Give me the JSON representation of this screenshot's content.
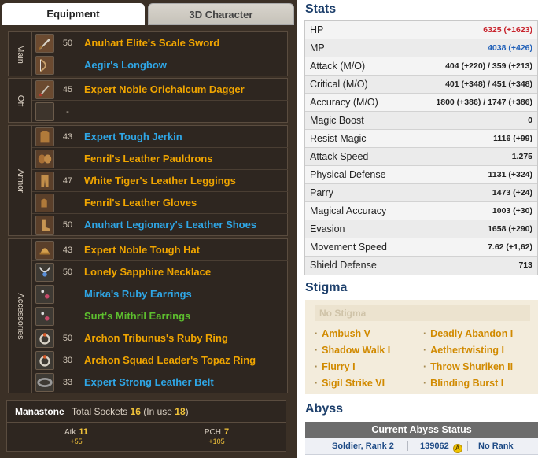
{
  "tabs": {
    "equipment": "Equipment",
    "character_3d": "3D Character"
  },
  "groups": {
    "main": "Main",
    "off": "Off",
    "armor": "Armor",
    "accessories": "Accessories"
  },
  "items": {
    "main": [
      {
        "level": "50",
        "name": "Anuhart Elite's Scale Sword",
        "icon": "sword-icon",
        "color": "#f0a500"
      },
      {
        "level": "",
        "name": "Aegir's Longbow",
        "icon": "bow-icon",
        "color": "#2fa6e6"
      }
    ],
    "off": [
      {
        "level": "45",
        "name": "Expert Noble Orichalcum Dagger",
        "icon": "dagger-icon",
        "color": "#f0a500"
      },
      {
        "level": "-",
        "name": "",
        "icon": "empty-slot-icon",
        "color": ""
      }
    ],
    "armor": [
      {
        "level": "43",
        "name": "Expert Tough Jerkin",
        "icon": "jerkin-icon",
        "color": "#2fa6e6"
      },
      {
        "level": "",
        "name": "Fenril's Leather Pauldrons",
        "icon": "pauldrons-icon",
        "color": "#f0a500"
      },
      {
        "level": "47",
        "name": "White Tiger's Leather Leggings",
        "icon": "leggings-icon",
        "color": "#f0a500"
      },
      {
        "level": "",
        "name": "Fenril's Leather Gloves",
        "icon": "gloves-icon",
        "color": "#f0a500"
      },
      {
        "level": "50",
        "name": "Anuhart Legionary's Leather Shoes",
        "icon": "shoes-icon",
        "color": "#2fa6e6"
      }
    ],
    "accessories": [
      {
        "level": "43",
        "name": "Expert Noble Tough Hat",
        "icon": "hat-icon",
        "color": "#f0a500"
      },
      {
        "level": "50",
        "name": "Lonely Sapphire Necklace",
        "icon": "necklace-icon",
        "color": "#f0a500"
      },
      {
        "level": "",
        "name": "Mirka's Ruby Earrings",
        "icon": "earrings-icon",
        "color": "#2fa6e6"
      },
      {
        "level": "",
        "name": "Surt's Mithril Earrings",
        "icon": "earrings-icon",
        "color": "#5dbf2e"
      },
      {
        "level": "50",
        "name": "Archon Tribunus's Ruby Ring",
        "icon": "ring-icon",
        "color": "#f0a500"
      },
      {
        "level": "30",
        "name": "Archon Squad Leader's Topaz Ring",
        "icon": "ring-icon",
        "color": "#f0a500"
      },
      {
        "level": "33",
        "name": "Expert Strong Leather Belt",
        "icon": "belt-icon",
        "color": "#2fa6e6"
      }
    ]
  },
  "manastone": {
    "title": "Manastone",
    "total_label": "Total Sockets",
    "total_value": "16",
    "in_use_label": "(In use",
    "in_use_value": "18",
    "in_use_close": ")",
    "atk_label": "Atk",
    "atk_value": "11",
    "atk_bonus": "+55",
    "pch_label": "PCH",
    "pch_value": "7",
    "pch_bonus": "+105"
  },
  "stats_title": "Stats",
  "stats": [
    {
      "label": "HP",
      "value": "6325 (+1623)",
      "color": "red"
    },
    {
      "label": "MP",
      "value": "4038 (+426)",
      "color": "blue"
    },
    {
      "label": "Attack (M/O)",
      "value": "404 (+220) / 359 (+213)",
      "color": ""
    },
    {
      "label": "Critical (M/O)",
      "value": "401 (+348) / 451 (+348)",
      "color": ""
    },
    {
      "label": "Accuracy (M/O)",
      "value": "1800 (+386) / 1747 (+386)",
      "color": ""
    },
    {
      "label": "Magic Boost",
      "value": "0",
      "color": ""
    },
    {
      "label": "Resist Magic",
      "value": "1116 (+99)",
      "color": ""
    },
    {
      "label": "Attack Speed",
      "value": "1.275",
      "color": ""
    },
    {
      "label": "Physical Defense",
      "value": "1131 (+324)",
      "color": ""
    },
    {
      "label": "Parry",
      "value": "1473 (+24)",
      "color": ""
    },
    {
      "label": "Magical Accuracy",
      "value": "1003 (+30)",
      "color": ""
    },
    {
      "label": "Evasion",
      "value": "1658 (+290)",
      "color": ""
    },
    {
      "label": "Movement Speed",
      "value": "7.62 (+1,62)",
      "color": ""
    },
    {
      "label": "Shield Defense",
      "value": "713",
      "color": ""
    }
  ],
  "stigma_title": "Stigma",
  "no_stigma": "No Stigma",
  "stigma_left": [
    "Ambush V",
    "Shadow Walk I",
    "Flurry I",
    "Sigil Strike VI"
  ],
  "stigma_right": [
    "Deadly Abandon I",
    "Aethertwisting I",
    "Throw Shuriken II",
    "Blinding Burst I"
  ],
  "abyss_title": "Abyss",
  "abyss": {
    "header": "Current Abyss Status",
    "rank": "Soldier, Rank 2",
    "points": "139062",
    "coin_letter": "A",
    "standing": "No Rank"
  }
}
